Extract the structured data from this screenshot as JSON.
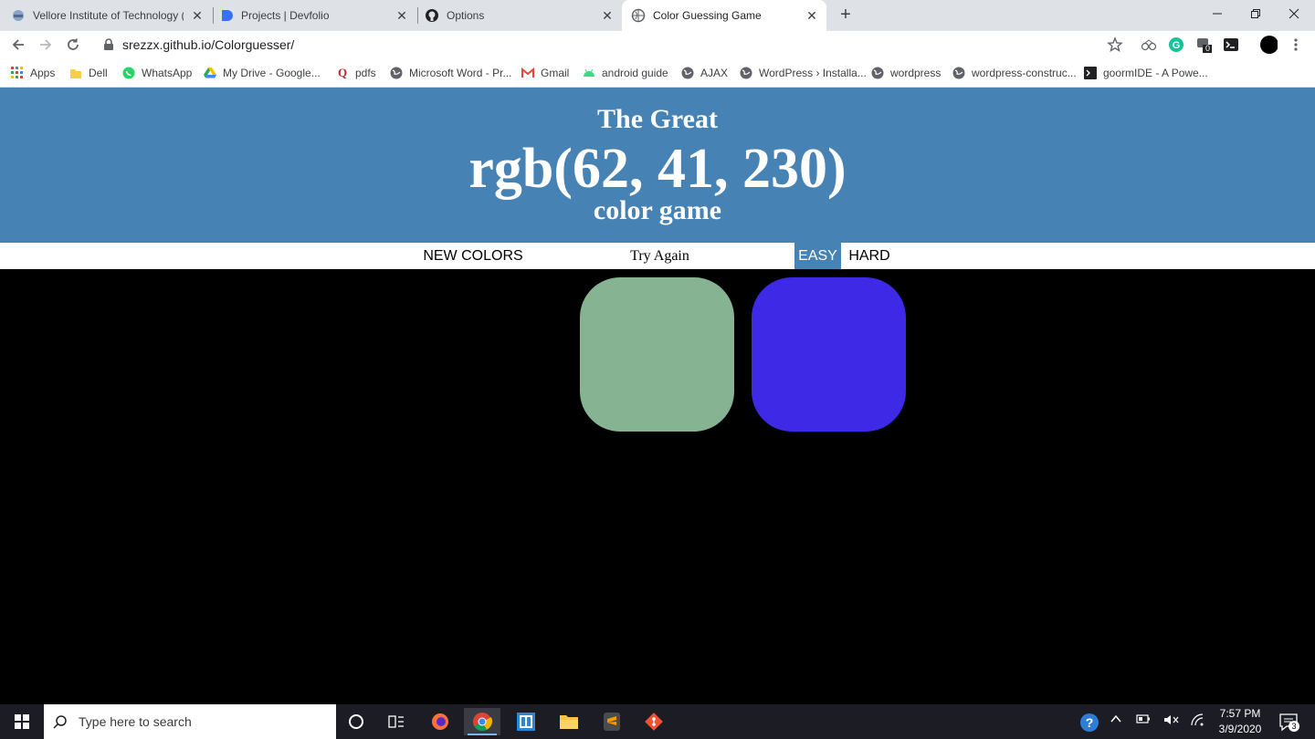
{
  "browser": {
    "tabs": [
      {
        "title": "Vellore Institute of Technology (V",
        "active": false
      },
      {
        "title": "Projects | Devfolio",
        "active": false
      },
      {
        "title": "Options",
        "active": false
      },
      {
        "title": "Color Guessing Game",
        "active": true
      }
    ],
    "new_tab": "+",
    "url": "srezzx.github.io/Colorguesser/",
    "extension_badge": "0",
    "bookmarks": [
      {
        "label": "Apps",
        "icon": "apps-grid-icon"
      },
      {
        "label": "Dell",
        "icon": "folder-icon"
      },
      {
        "label": "WhatsApp",
        "icon": "whatsapp-icon"
      },
      {
        "label": "My Drive - Google...",
        "icon": "google-drive-icon"
      },
      {
        "label": "pdfs",
        "icon": "quora-icon"
      },
      {
        "label": "Microsoft Word - Pr...",
        "icon": "globe-icon"
      },
      {
        "label": "Gmail",
        "icon": "gmail-icon"
      },
      {
        "label": "android guide",
        "icon": "android-icon"
      },
      {
        "label": "AJAX",
        "icon": "globe-icon"
      },
      {
        "label": "WordPress › Installa...",
        "icon": "globe-icon"
      },
      {
        "label": "wordpress",
        "icon": "globe-icon"
      },
      {
        "label": "wordpress-construc...",
        "icon": "globe-icon"
      },
      {
        "label": "goormIDE - A Powe...",
        "icon": "terminal-icon"
      }
    ]
  },
  "game": {
    "title_top": "The Great",
    "target_color": "rgb(62, 41, 230)",
    "title_bottom": "color game",
    "new_colors_label": "NEW COLORS",
    "message": "Try Again",
    "easy_label": "EASY",
    "hard_label": "HARD",
    "header_color": "#4682b4",
    "squares": [
      "#86b492",
      "#3e29e6"
    ]
  },
  "taskbar": {
    "search_placeholder": "Type here to search",
    "time": "7:57 PM",
    "date": "3/9/2020",
    "notification_count": "3"
  }
}
